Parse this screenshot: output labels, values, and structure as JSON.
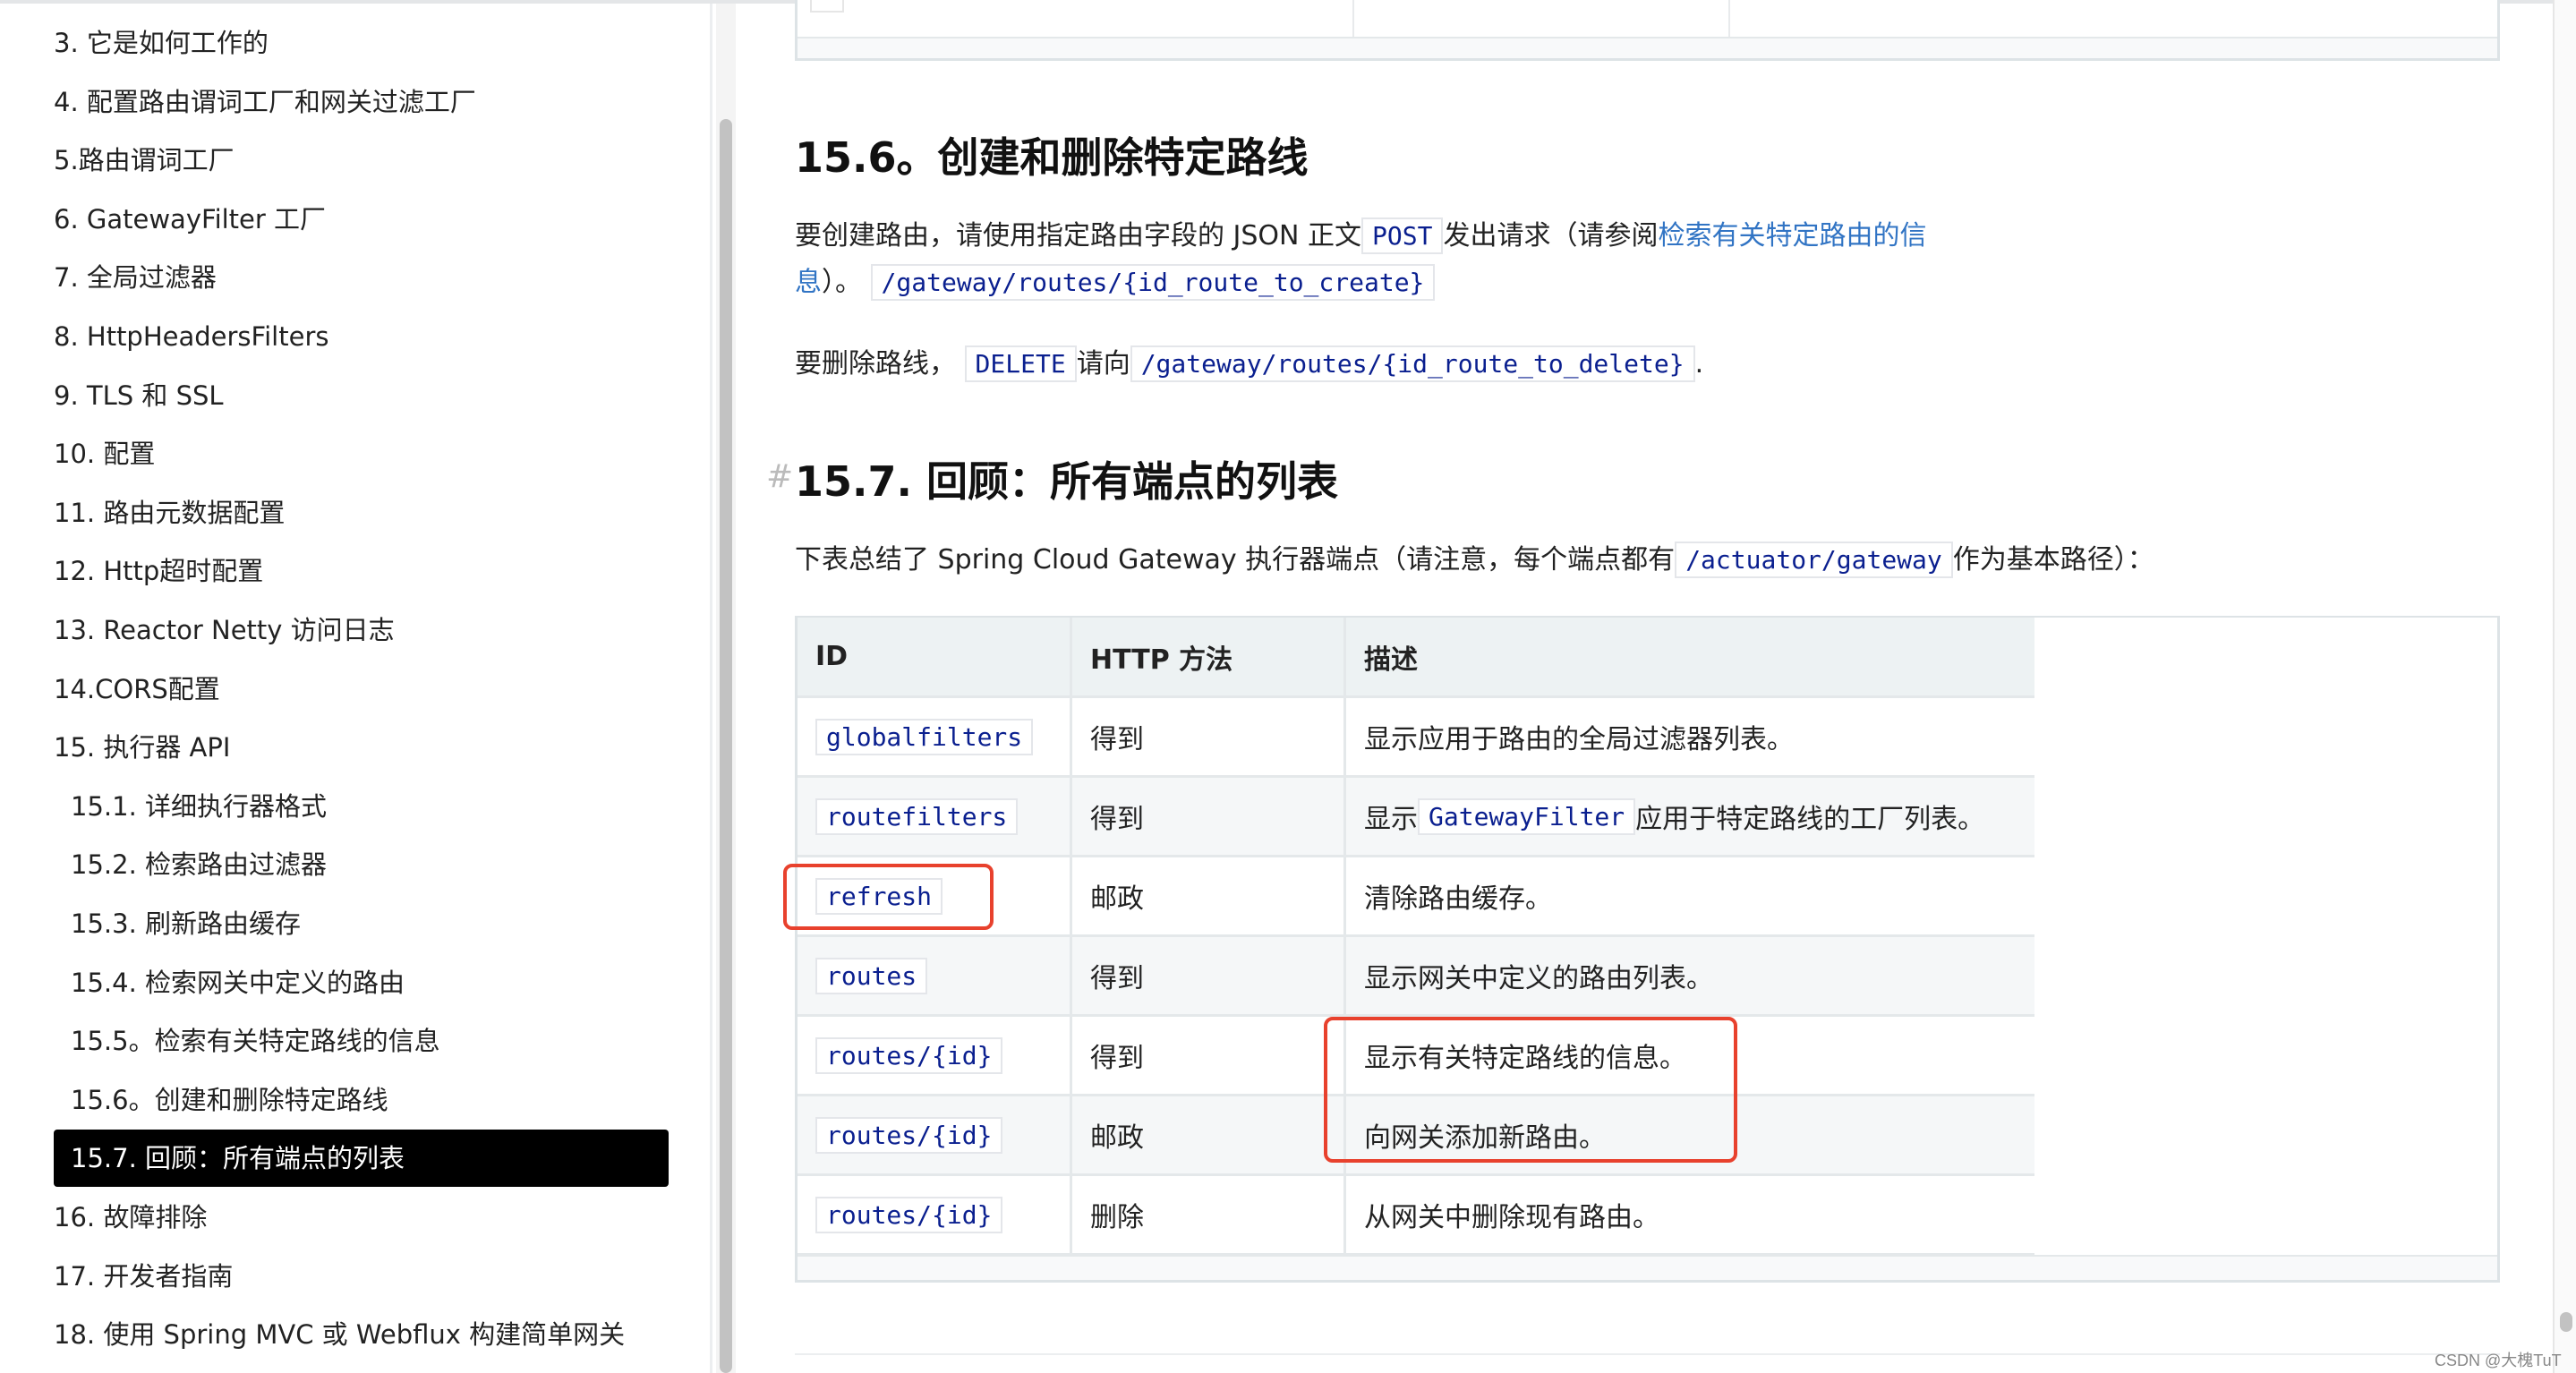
{
  "sidebar": {
    "items": [
      {
        "label": "3. 它是如何工作的"
      },
      {
        "label": "4. 配置路由谓词工厂和网关过滤工厂"
      },
      {
        "label": "5.路由谓词工厂"
      },
      {
        "label": "6. GatewayFilter 工厂"
      },
      {
        "label": "7. 全局过滤器"
      },
      {
        "label": "8. HttpHeadersFilters"
      },
      {
        "label": "9. TLS 和 SSL"
      },
      {
        "label": "10. 配置"
      },
      {
        "label": "11. 路由元数据配置"
      },
      {
        "label": "12. Http超时配置"
      },
      {
        "label": "13. Reactor Netty 访问日志"
      },
      {
        "label": "14.CORS配置"
      },
      {
        "label": "15. 执行器 API"
      },
      {
        "label": "15.1. 详细执行器格式",
        "sub": true
      },
      {
        "label": "15.2. 检索路由过滤器",
        "sub": true
      },
      {
        "label": "15.3. 刷新路由缓存",
        "sub": true
      },
      {
        "label": "15.4. 检索网关中定义的路由",
        "sub": true
      },
      {
        "label": "15.5。检索有关特定路线的信息",
        "sub": true
      },
      {
        "label": "15.6。创建和删除特定路线",
        "sub": true
      },
      {
        "label": "15.7. 回顾：所有端点的列表",
        "sub": true,
        "active": true
      },
      {
        "label": "16. 故障排除"
      },
      {
        "label": "17. 开发者指南"
      },
      {
        "label": "18. 使用 Spring MVC 或 Webflux 构建简单网关"
      }
    ]
  },
  "section156": {
    "title": "15.6。创建和删除特定路线",
    "p1_a": "要创建路由，请使用指定路由字段的 JSON 正文",
    "p1_code": "POST",
    "p1_b": "发出请求（请参阅",
    "p1_link_1": "检索有关特定路由的信",
    "p1_link_2": "息",
    "p1_c": "）。",
    "p1_code2": "/gateway/routes/{id_route_to_create}",
    "p2_a": "要删除路线，",
    "p2_code": "DELETE",
    "p2_b": "请向",
    "p2_code2": "/gateway/routes/{id_route_to_delete}",
    "p2_c": "."
  },
  "section157": {
    "anchor": "#",
    "title": "15.7. 回顾：所有端点的列表",
    "intro_a": "下表总结了 Spring Cloud Gateway 执行器端点（请注意，每个端点都有",
    "intro_code": "/actuator/gateway",
    "intro_b": "作为基本路径）："
  },
  "table": {
    "headers": [
      "ID",
      "HTTP 方法",
      "描述"
    ],
    "rows": [
      {
        "id": "globalfilters",
        "method": "得到",
        "desc": "显示应用于路由的全局过滤器列表。"
      },
      {
        "id": "routefilters",
        "method": "得到",
        "desc_a": "显示",
        "desc_code": "GatewayFilter",
        "desc_b": "应用于特定路线的工厂列表。"
      },
      {
        "id": "refresh",
        "method": "邮政",
        "desc": "清除路由缓存。"
      },
      {
        "id": "routes",
        "method": "得到",
        "desc": "显示网关中定义的路由列表。"
      },
      {
        "id": "routes/{id}",
        "method": "得到",
        "desc": "显示有关特定路线的信息。"
      },
      {
        "id": "routes/{id}",
        "method": "邮政",
        "desc": "向网关添加新路由。"
      },
      {
        "id": "routes/{id}",
        "method": "删除",
        "desc": "从网关中删除现有路由。"
      }
    ]
  },
  "annotation_color": "#e8412d",
  "watermark": "CSDN @大槐TuT"
}
